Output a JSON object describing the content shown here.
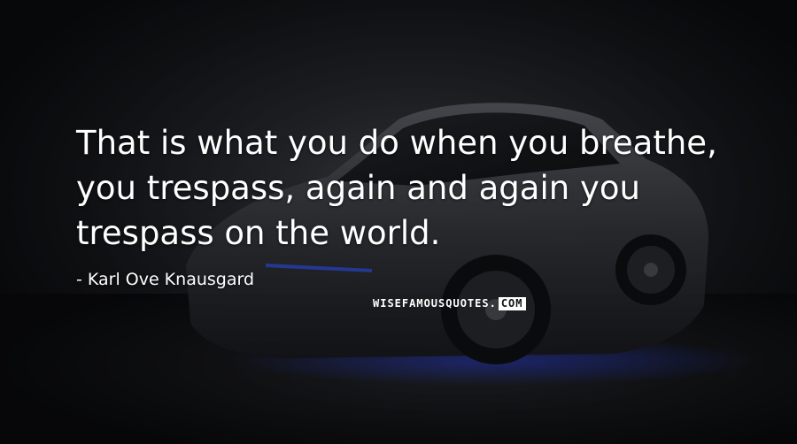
{
  "quote": {
    "lines": [
      "That is what you do when you breathe,",
      "you trespass, again and again you",
      "trespass on the world."
    ]
  },
  "author": {
    "dash": "-",
    "name": "Karl Ove Knausgard"
  },
  "watermark": {
    "main": "WISEFAMOUSQUOTES.",
    "box": "COM"
  },
  "background": {
    "subject": "car-image",
    "accent_color": "#1e3cff"
  }
}
